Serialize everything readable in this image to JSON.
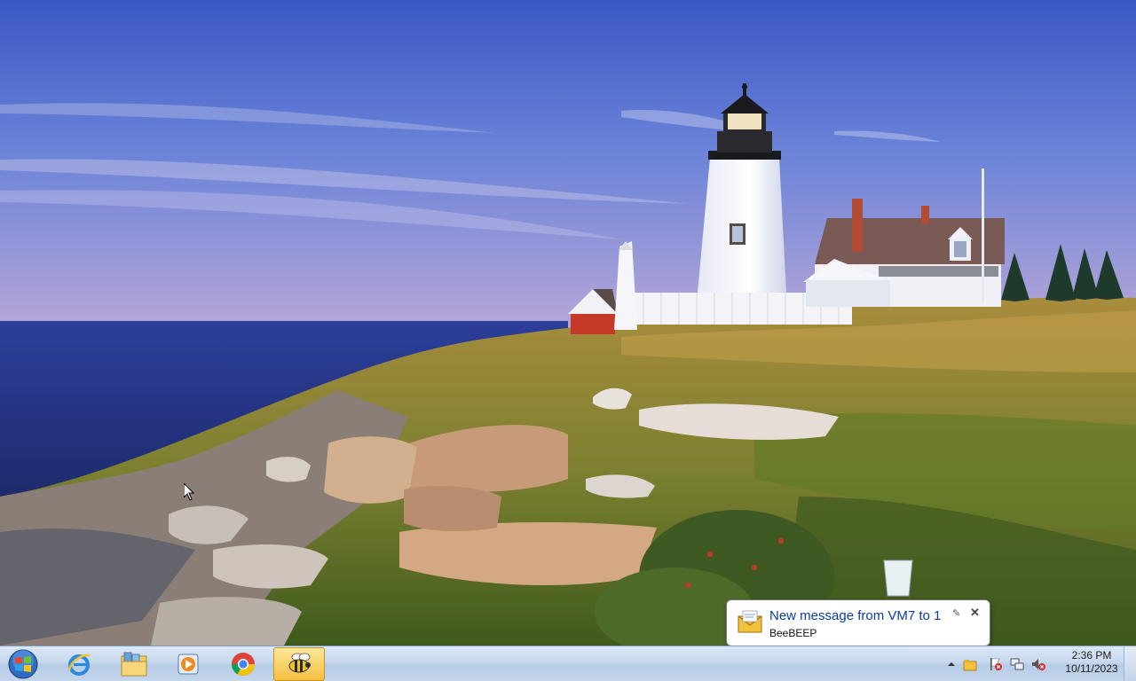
{
  "desktop": {
    "wallpaper": "lighthouse-on-rocky-coast-sunset"
  },
  "taskbar": {
    "start_button": {
      "icon": "windows-start-orb"
    },
    "pinned": [
      {
        "name": "internet-explorer",
        "icon": "ie-icon",
        "active": false
      },
      {
        "name": "windows-explorer",
        "icon": "folder-library-icon",
        "active": false
      },
      {
        "name": "windows-media-player",
        "icon": "media-player-icon",
        "active": false
      },
      {
        "name": "google-chrome",
        "icon": "chrome-icon",
        "active": false
      },
      {
        "name": "beebeep",
        "icon": "bee-icon",
        "active": true
      }
    ],
    "tray": {
      "icons": [
        "show-hidden-icons-chevron",
        "beebeep-tray-icon",
        "action-center-flag-icon",
        "network-icon",
        "volume-muted-icon"
      ],
      "clock": {
        "time": "2:36 PM",
        "date": "10/11/2023"
      }
    }
  },
  "notification": {
    "title": "New message from VM7 to 1",
    "app_name": "BeeBEEP",
    "pin_glyph": "✎",
    "close_glyph": "✕"
  },
  "colors": {
    "taskbar": "#c7d8ee",
    "balloon_title": "#0a3ea0",
    "active_button": "#f4c040"
  }
}
